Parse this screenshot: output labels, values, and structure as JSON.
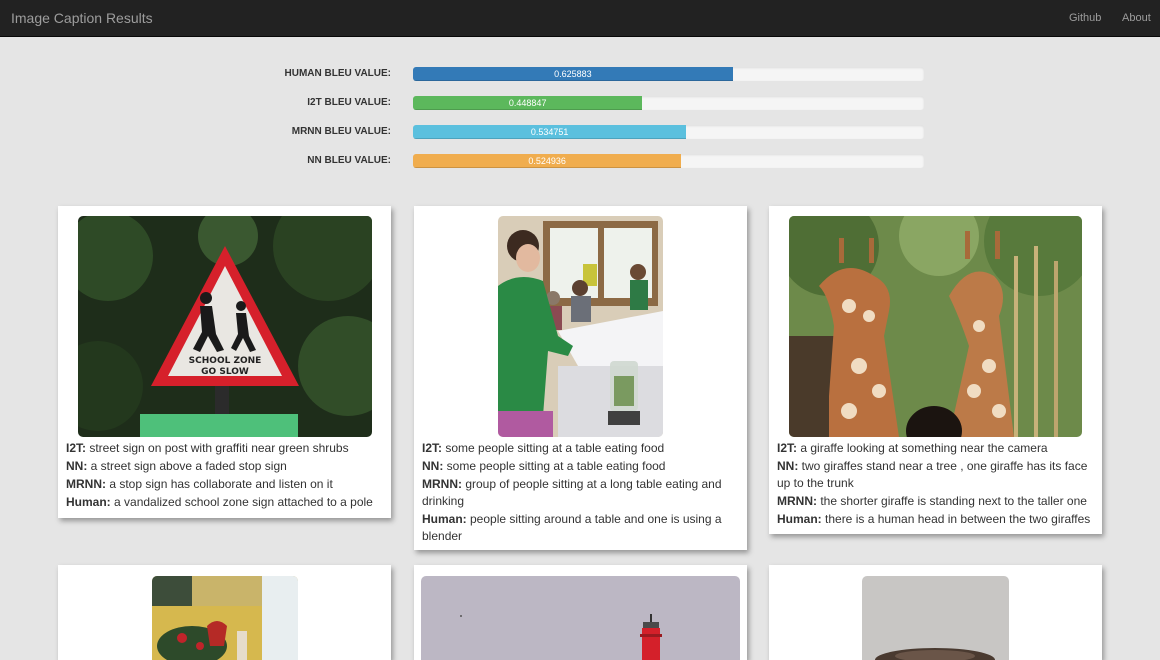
{
  "navbar": {
    "brand": "Image Caption Results",
    "links": [
      "Github",
      "About"
    ]
  },
  "bleu": [
    {
      "label": "HUMAN BLEU VALUE:",
      "value": "0.625883",
      "fraction": 0.625883,
      "color": "#337ab7"
    },
    {
      "label": "I2T BLEU VALUE:",
      "value": "0.448847",
      "fraction": 0.448847,
      "color": "#5cb85c"
    },
    {
      "label": "MRNN BLEU VALUE:",
      "value": "0.534751",
      "fraction": 0.534751,
      "color": "#5bc0de"
    },
    {
      "label": "NN BLEU VALUE:",
      "value": "0.524936",
      "fraction": 0.524936,
      "color": "#f0ad4e"
    }
  ],
  "cards": [
    {
      "image_icon": "school-zone-sign-photo",
      "sign_text": [
        "SCHOOL ZONE",
        "GO SLOW"
      ],
      "captions": [
        {
          "key": "I2T:",
          "text": " street sign on post with graffiti near green shrubs"
        },
        {
          "key": "NN:",
          "text": " a street sign above a faded stop sign"
        },
        {
          "key": "MRNN:",
          "text": " a stop sign has collaborate and listen on it"
        },
        {
          "key": "Human:",
          "text": " a vandalized school zone sign attached to a pole"
        }
      ]
    },
    {
      "image_icon": "people-at-table-photo",
      "captions": [
        {
          "key": "I2T:",
          "text": " some people sitting at a table eating food"
        },
        {
          "key": "NN:",
          "text": " some people sitting at a table eating food"
        },
        {
          "key": "MRNN:",
          "text": " group of people sitting at a long table eating and drinking"
        },
        {
          "key": "Human:",
          "text": " people sitting around a table and one is using a blender"
        }
      ]
    },
    {
      "image_icon": "giraffes-photo",
      "captions": [
        {
          "key": "I2T:",
          "text": " a giraffe looking at something near the camera"
        },
        {
          "key": "NN:",
          "text": " two giraffes stand near a tree , one giraffe has its face up to the trunk"
        },
        {
          "key": "MRNN:",
          "text": " the shorter giraffe is standing next to the taller one"
        },
        {
          "key": "Human:",
          "text": " there is a human head in between the two giraffes"
        }
      ]
    },
    {
      "image_icon": "christmas-decor-photo"
    },
    {
      "image_icon": "red-lighthouse-photo"
    },
    {
      "image_icon": "food-plate-photo"
    }
  ]
}
